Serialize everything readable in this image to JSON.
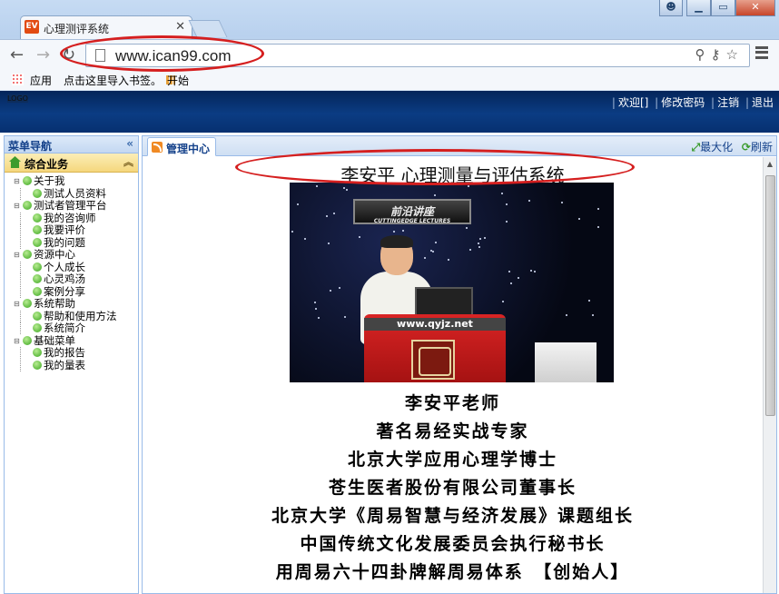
{
  "browser": {
    "tab_title": "心理测评系统",
    "tab_favicon": "EV",
    "url": "www.ican99.com",
    "bookmarks": {
      "apps_label": "应用",
      "import_label": "点击这里导入书签。",
      "start_label": "开始"
    }
  },
  "header": {
    "logo": "LOGO",
    "links": {
      "welcome": "欢迎[]",
      "change_password": "修改密码",
      "logout": "注销",
      "exit": "退出"
    }
  },
  "sidebar": {
    "title": "菜单导航",
    "collapse_icon": "«",
    "section": "综合业务",
    "tree": [
      {
        "label": "关于我",
        "children": [
          {
            "label": "测试人员资料"
          }
        ]
      },
      {
        "label": "测试者管理平台",
        "children": [
          {
            "label": "我的咨询师"
          },
          {
            "label": "我要评价"
          },
          {
            "label": "我的问题"
          }
        ]
      },
      {
        "label": "资源中心",
        "children": [
          {
            "label": "个人成长"
          },
          {
            "label": "心灵鸡汤"
          },
          {
            "label": "案例分享"
          }
        ]
      },
      {
        "label": "系统帮助",
        "children": [
          {
            "label": "帮助和使用方法"
          },
          {
            "label": "系统简介"
          }
        ]
      },
      {
        "label": "基础菜单",
        "children": [
          {
            "label": "我的报告"
          },
          {
            "label": "我的量表"
          }
        ]
      }
    ]
  },
  "main": {
    "tab_label": "管理中心",
    "maximize_label": "最大化",
    "refresh_label": "刷新",
    "title": "李安平 心理测量与评估系统",
    "photo": {
      "banner_text": "前沿讲座",
      "banner_sub": "CUTTINGEDGE LECTURES",
      "podium_site": "www.qyjz.net"
    },
    "bio_lines": [
      "李安平老师",
      "著名易经实战专家",
      "北京大学应用心理学博士",
      "苍生医者股份有限公司董事长",
      "北京大学《周易智慧与经济发展》课题组长",
      "中国传统文化发展委员会执行秘书长",
      "用周易六十四卦牌解周易体系　【创始人】"
    ]
  },
  "colors": {
    "header_bg": "#0b3c83",
    "panel_border": "#99bbe8",
    "section_bg": "#f5d77d",
    "annotation_red": "#d51f1f"
  }
}
